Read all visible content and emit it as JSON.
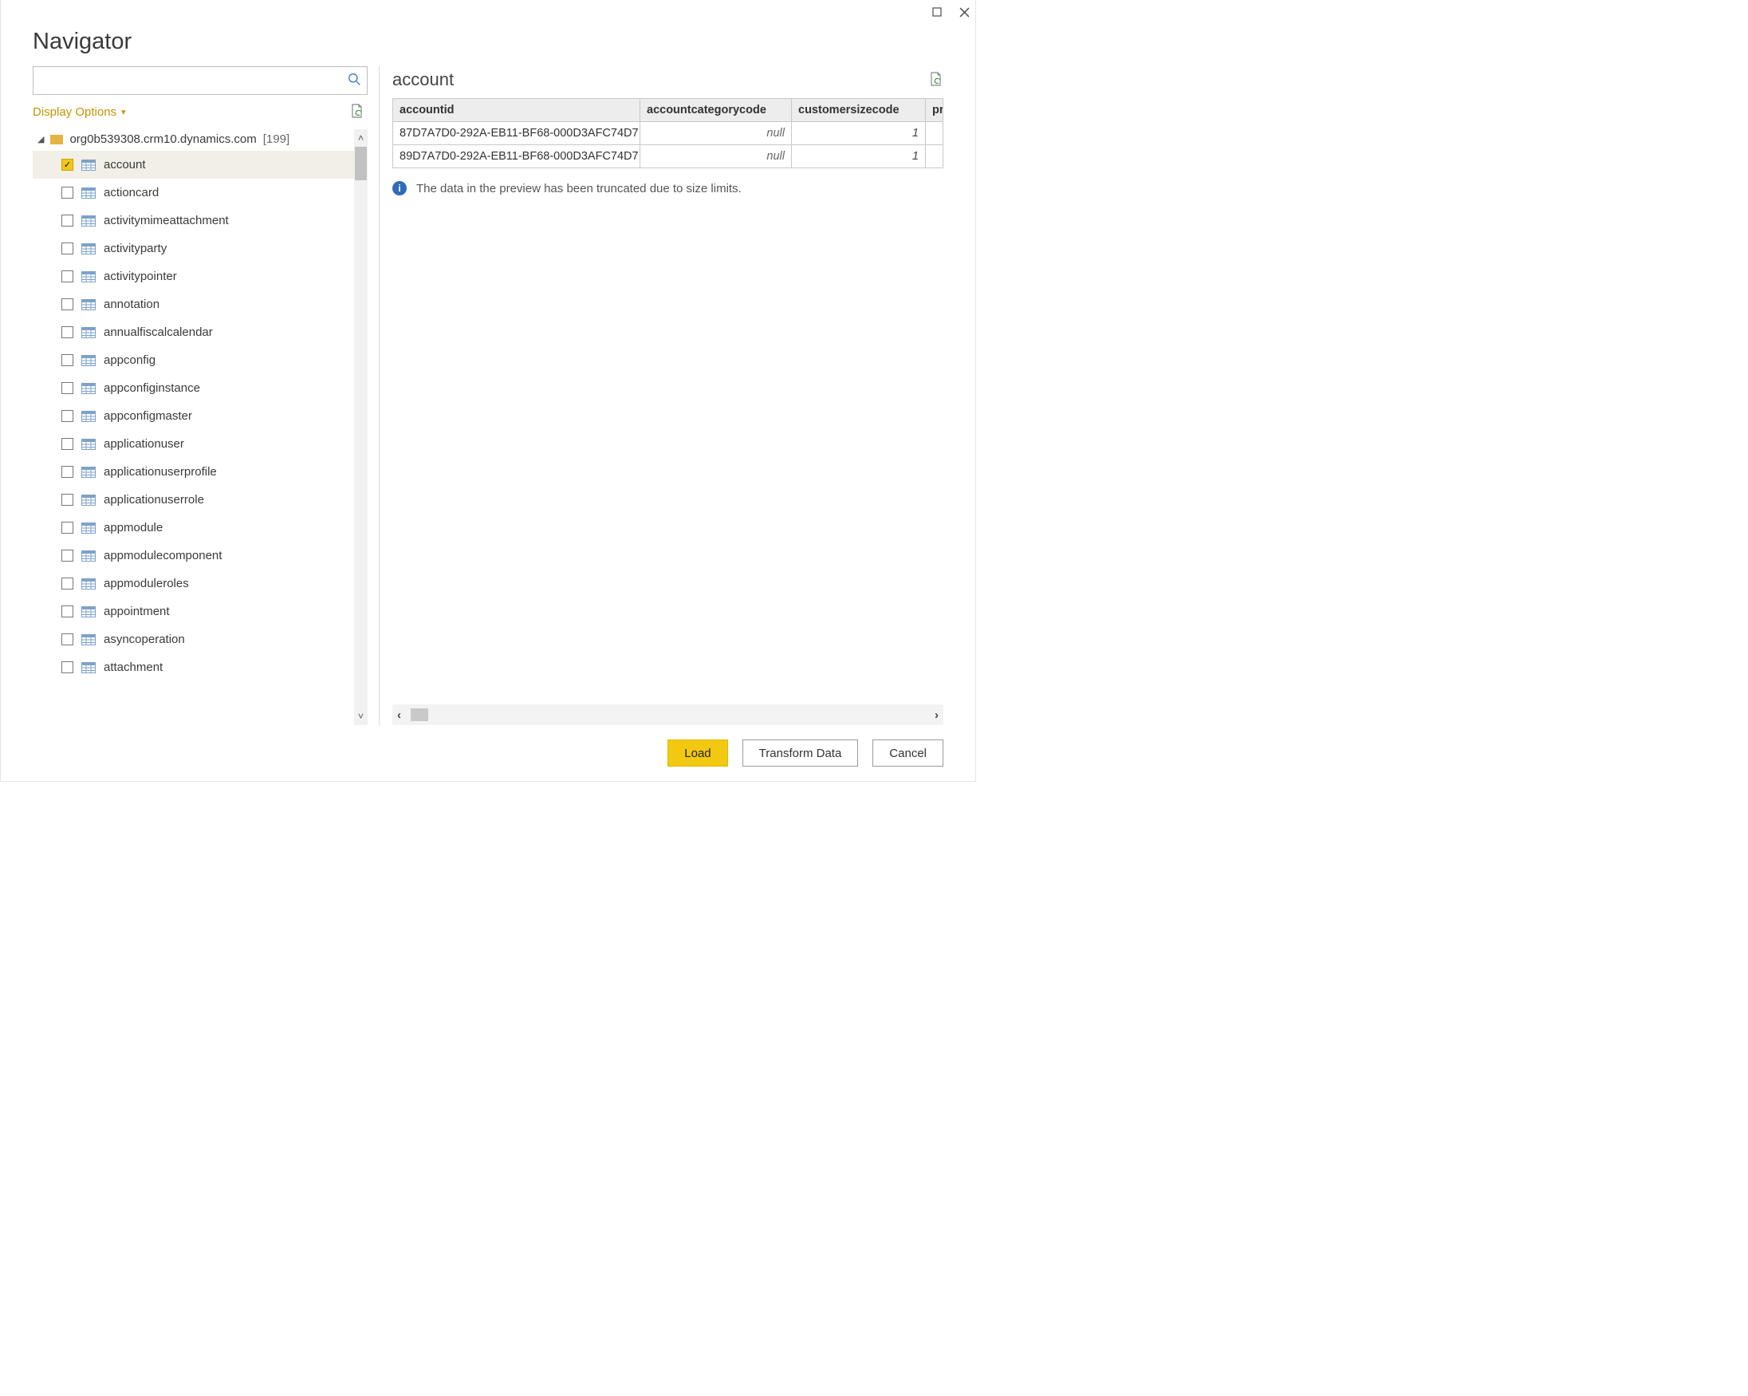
{
  "window": {
    "title": "Navigator"
  },
  "search": {
    "value": "",
    "placeholder": ""
  },
  "displayOptions": {
    "label": "Display Options"
  },
  "tree": {
    "root": {
      "label": "org0b539308.crm10.dynamics.com",
      "count": "[199]",
      "expanded": true
    },
    "items": [
      {
        "label": "account",
        "checked": true,
        "selected": true
      },
      {
        "label": "actioncard",
        "checked": false
      },
      {
        "label": "activitymimeattachment",
        "checked": false
      },
      {
        "label": "activityparty",
        "checked": false
      },
      {
        "label": "activitypointer",
        "checked": false
      },
      {
        "label": "annotation",
        "checked": false
      },
      {
        "label": "annualfiscalcalendar",
        "checked": false
      },
      {
        "label": "appconfig",
        "checked": false
      },
      {
        "label": "appconfiginstance",
        "checked": false
      },
      {
        "label": "appconfigmaster",
        "checked": false
      },
      {
        "label": "applicationuser",
        "checked": false
      },
      {
        "label": "applicationuserprofile",
        "checked": false
      },
      {
        "label": "applicationuserrole",
        "checked": false
      },
      {
        "label": "appmodule",
        "checked": false
      },
      {
        "label": "appmodulecomponent",
        "checked": false
      },
      {
        "label": "appmoduleroles",
        "checked": false
      },
      {
        "label": "appointment",
        "checked": false
      },
      {
        "label": "asyncoperation",
        "checked": false
      },
      {
        "label": "attachment",
        "checked": false
      }
    ]
  },
  "preview": {
    "title": "account",
    "columns": [
      "accountid",
      "accountcategorycode",
      "customersizecode",
      "pr"
    ],
    "rows": [
      {
        "accountid": "87D7A7D0-292A-EB11-BF68-000D3AFC74D7",
        "accountcategorycode": "null",
        "customersizecode": "1"
      },
      {
        "accountid": "89D7A7D0-292A-EB11-BF68-000D3AFC74D7",
        "accountcategorycode": "null",
        "customersizecode": "1"
      }
    ],
    "infoMessage": "The data in the preview has been truncated due to size limits."
  },
  "footer": {
    "load": "Load",
    "transform": "Transform Data",
    "cancel": "Cancel"
  }
}
